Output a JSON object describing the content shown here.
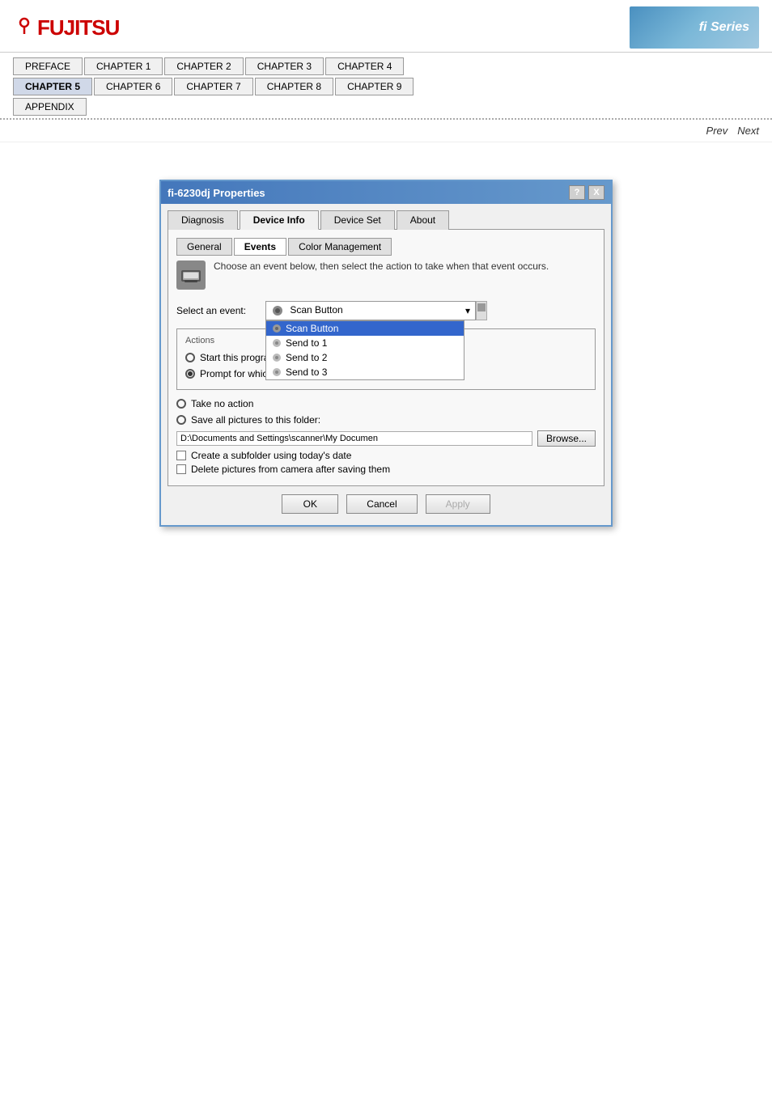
{
  "header": {
    "logo": "FUJITSU",
    "badge_text": "fi Series"
  },
  "nav": {
    "row1": [
      {
        "label": "PREFACE",
        "active": false
      },
      {
        "label": "CHAPTER 1",
        "active": false
      },
      {
        "label": "CHAPTER 2",
        "active": false
      },
      {
        "label": "CHAPTER 3",
        "active": false
      },
      {
        "label": "CHAPTER 4",
        "active": false
      }
    ],
    "row2": [
      {
        "label": "CHAPTER 5",
        "active": true
      },
      {
        "label": "CHAPTER 6",
        "active": false
      },
      {
        "label": "CHAPTER 7",
        "active": false
      },
      {
        "label": "CHAPTER 8",
        "active": false
      },
      {
        "label": "CHAPTER 9",
        "active": false
      }
    ],
    "row3": [
      {
        "label": "APPENDIX",
        "active": false
      }
    ]
  },
  "prevnext": {
    "prev_label": "Prev",
    "next_label": "Next"
  },
  "dialog": {
    "title": "fi-6230dj Properties",
    "tabs": [
      {
        "label": "Diagnosis",
        "active": false
      },
      {
        "label": "Device Info",
        "active": false
      },
      {
        "label": "Device Set",
        "active": false
      },
      {
        "label": "About",
        "active": false
      }
    ],
    "sub_tabs": [
      {
        "label": "General",
        "active": false
      },
      {
        "label": "Events",
        "active": true
      },
      {
        "label": "Color Management",
        "active": false
      }
    ],
    "events_desc": "Choose an event below, then select the action to take when that event occurs.",
    "select_event_label": "Select an event:",
    "event_current": "Scan Button",
    "event_dropdown_items": [
      {
        "label": "Scan Button",
        "selected": true
      },
      {
        "label": "Send to 1",
        "selected": false
      },
      {
        "label": "Send to 2",
        "selected": false
      },
      {
        "label": "Send to 3",
        "selected": false
      }
    ],
    "actions_title": "Actions",
    "radio_start": "Start this program:",
    "radio_prompt": "Prompt for which program to run",
    "radio_take_no_action": "Take no action",
    "radio_save": "Save all pictures to this folder:",
    "folder_path": "D:\\Documents and Settings\\scanner\\My Documen",
    "browse_label": "Browse...",
    "checkbox_subfolder": "Create a subfolder using today's date",
    "checkbox_delete": "Delete pictures from camera after saving them",
    "btn_ok": "OK",
    "btn_cancel": "Cancel",
    "btn_apply": "Apply",
    "help_btn": "?",
    "close_btn": "X"
  }
}
